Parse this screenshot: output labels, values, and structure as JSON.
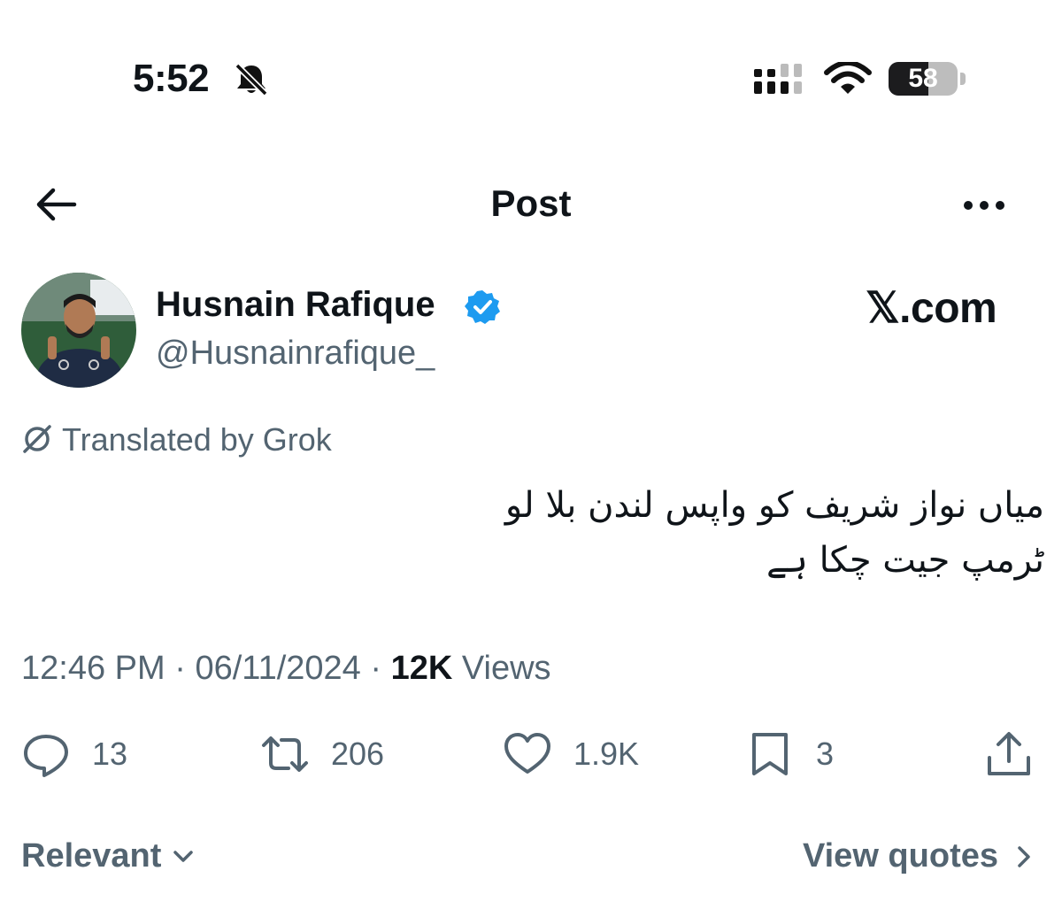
{
  "status_bar": {
    "time": "5:52",
    "battery_level": "58",
    "battery_fraction": 0.58,
    "icons": [
      "bell-slash-icon",
      "cellular-signal-icon",
      "wifi-icon",
      "battery-icon"
    ]
  },
  "nav": {
    "title": "Post",
    "back_icon": "arrow-left-icon",
    "more_icon": "more-horizontal-icon"
  },
  "author": {
    "name": "Husnain Rafique",
    "handle": "@Husnainrafique_",
    "verified_icon": "verified-badge-icon"
  },
  "site_label": "𝕏.com",
  "translation": {
    "label": "Translated by Grok",
    "icon": "grok-icon"
  },
  "tweet": {
    "text_line1": "میاں نواز شریف کو واپس لندن بلا لو",
    "text_line2": "ٹرمپ جیت چکا ہے"
  },
  "meta": {
    "time": "12:46 PM",
    "separator": "·",
    "date": "06/11/2024",
    "views_count": "12K",
    "views_label": "Views"
  },
  "actions": {
    "replies": "13",
    "reposts": "206",
    "likes": "1.9K",
    "bookmarks": "3"
  },
  "footer": {
    "sort_label": "Relevant",
    "quotes_label": "View quotes"
  },
  "colors": {
    "text": "#0f1419",
    "secondary": "#536471",
    "verified": "#1d9bf0"
  }
}
